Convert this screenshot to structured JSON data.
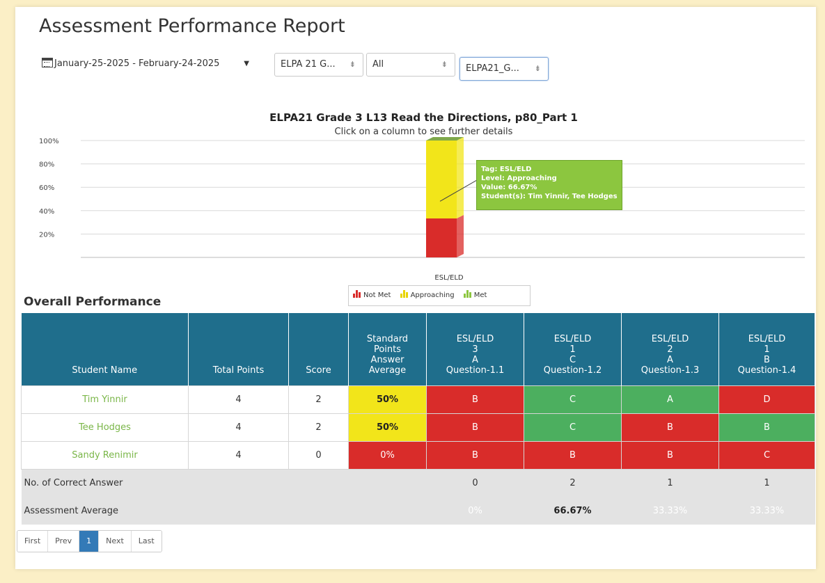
{
  "header": {
    "title": "Assessment Performance Report"
  },
  "filters": {
    "date_range": "January-25-2025 - February-24-2025",
    "grade": "ELPA 21 G...",
    "group": "All",
    "tag": "ELPA21_G..."
  },
  "chart_data": {
    "type": "bar",
    "stacked": true,
    "title": "ELPA21 Grade 3 L13 Read the Directions, p80_Part 1",
    "subtitle": "Click on a column to see further details",
    "categories": [
      "ESL/ELD"
    ],
    "yticks": [
      "100%",
      "80%",
      "60%",
      "40%",
      "20%"
    ],
    "ylim": [
      0,
      100
    ],
    "series": [
      {
        "name": "Not Met",
        "color": "#d92c2a",
        "values": [
          33.33
        ]
      },
      {
        "name": "Approaching",
        "color": "#f2e51a",
        "values": [
          66.67
        ]
      },
      {
        "name": "Met",
        "color": "#8cc63f",
        "values": [
          0
        ]
      }
    ],
    "tooltip": {
      "tag": "Tag: ESL/ELD",
      "level": "Level: Approaching",
      "value": "Value: 66.67%",
      "students": "Student(s): Tim Yinnir, Tee Hodges"
    }
  },
  "legend": {
    "not_met": "Not Met",
    "approaching": "Approaching",
    "met": "Met"
  },
  "section": {
    "title": "Overall Performance"
  },
  "table": {
    "headers": {
      "student_name": "Student Name",
      "total_points": "Total Points",
      "score": "Score",
      "std_avg": [
        "Standard",
        "Points",
        "Answer",
        "Average"
      ],
      "q1": [
        "ESL/ELD",
        "3",
        "A",
        "Question-1.1"
      ],
      "q2": [
        "ESL/ELD",
        "1",
        "C",
        "Question-1.2"
      ],
      "q3": [
        "ESL/ELD",
        "2",
        "A",
        "Question-1.3"
      ],
      "q4": [
        "ESL/ELD",
        "1",
        "B",
        "Question-1.4"
      ]
    },
    "rows": [
      {
        "name": "Tim Yinnir",
        "total": "4",
        "score": "2",
        "avg": "50%",
        "answers": [
          "B",
          "C",
          "A",
          "D"
        ]
      },
      {
        "name": "Tee Hodges",
        "total": "4",
        "score": "2",
        "avg": "50%",
        "answers": [
          "B",
          "C",
          "B",
          "B"
        ]
      },
      {
        "name": "Sandy Renimir",
        "total": "4",
        "score": "0",
        "avg": "0%",
        "answers": [
          "B",
          "B",
          "B",
          "C"
        ]
      }
    ],
    "correct_label": "No. of Correct Answer",
    "correct_counts": [
      "0",
      "2",
      "1",
      "1"
    ],
    "average_label": "Assessment Average",
    "averages": [
      "0%",
      "66.67%",
      "33.33%",
      "33.33%"
    ]
  },
  "pager": {
    "first": "First",
    "prev": "Prev",
    "current": "1",
    "next": "Next",
    "last": "Last"
  }
}
